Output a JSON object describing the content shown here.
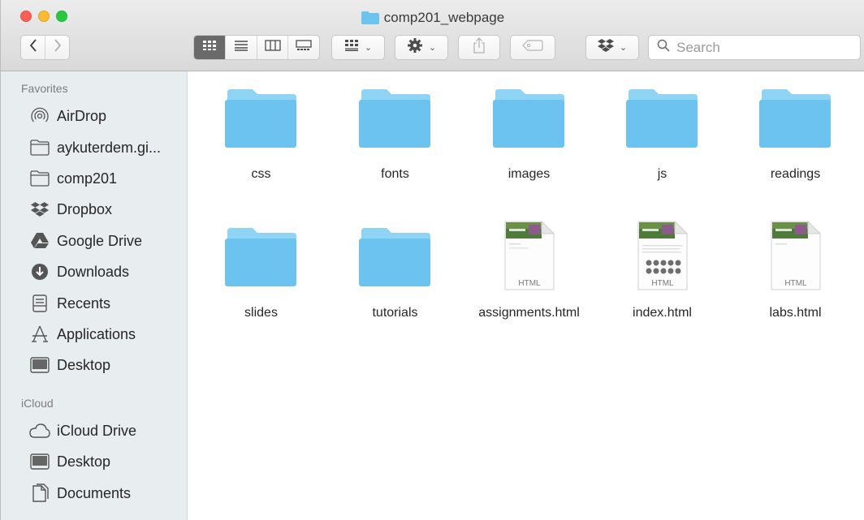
{
  "window": {
    "title": "comp201_webpage",
    "traffic_lights": {
      "close": "#fc5f57",
      "minimize": "#fdbc2e",
      "zoom": "#28c840"
    }
  },
  "toolbar": {
    "back_icon": "chevron-left-icon",
    "forward_icon": "chevron-right-icon",
    "view_modes": [
      "icon-view-icon",
      "list-view-icon",
      "column-view-icon",
      "gallery-view-icon"
    ],
    "group_icon": "group-by-icon",
    "action_icon": "gear-icon",
    "share_icon": "share-icon",
    "tag_icon": "tag-icon",
    "dropbox_icon": "dropbox-icon",
    "search": {
      "placeholder": "Search"
    }
  },
  "sidebar": {
    "favorites_title": "Favorites",
    "favorites": [
      {
        "label": "AirDrop",
        "icon": "airdrop-icon"
      },
      {
        "label": "aykuterdem.gi...",
        "icon": "folder-icon"
      },
      {
        "label": "comp201",
        "icon": "folder-icon"
      },
      {
        "label": "Dropbox",
        "icon": "dropbox-icon"
      },
      {
        "label": "Google Drive",
        "icon": "google-drive-icon"
      },
      {
        "label": "Downloads",
        "icon": "downloads-icon"
      },
      {
        "label": "Recents",
        "icon": "recents-icon"
      },
      {
        "label": "Applications",
        "icon": "applications-icon"
      },
      {
        "label": "Desktop",
        "icon": "desktop-icon"
      }
    ],
    "icloud_title": "iCloud",
    "icloud": [
      {
        "label": "iCloud Drive",
        "icon": "cloud-icon"
      },
      {
        "label": "Desktop",
        "icon": "desktop-icon"
      },
      {
        "label": "Documents",
        "icon": "documents-icon"
      }
    ]
  },
  "files": [
    {
      "name": "css",
      "kind": "folder"
    },
    {
      "name": "fonts",
      "kind": "folder"
    },
    {
      "name": "images",
      "kind": "folder"
    },
    {
      "name": "js",
      "kind": "folder"
    },
    {
      "name": "readings",
      "kind": "folder"
    },
    {
      "name": "slides",
      "kind": "folder"
    },
    {
      "name": "tutorials",
      "kind": "folder"
    },
    {
      "name": "assignments.html",
      "kind": "html",
      "badge": "HTML"
    },
    {
      "name": "index.html",
      "kind": "html",
      "badge": "HTML"
    },
    {
      "name": "labs.html",
      "kind": "html",
      "badge": "HTML"
    }
  ],
  "colors": {
    "folder": "#6cc3f0",
    "folder_tab": "#8fd3f5",
    "sidebar_bg": "#e8eef0"
  }
}
